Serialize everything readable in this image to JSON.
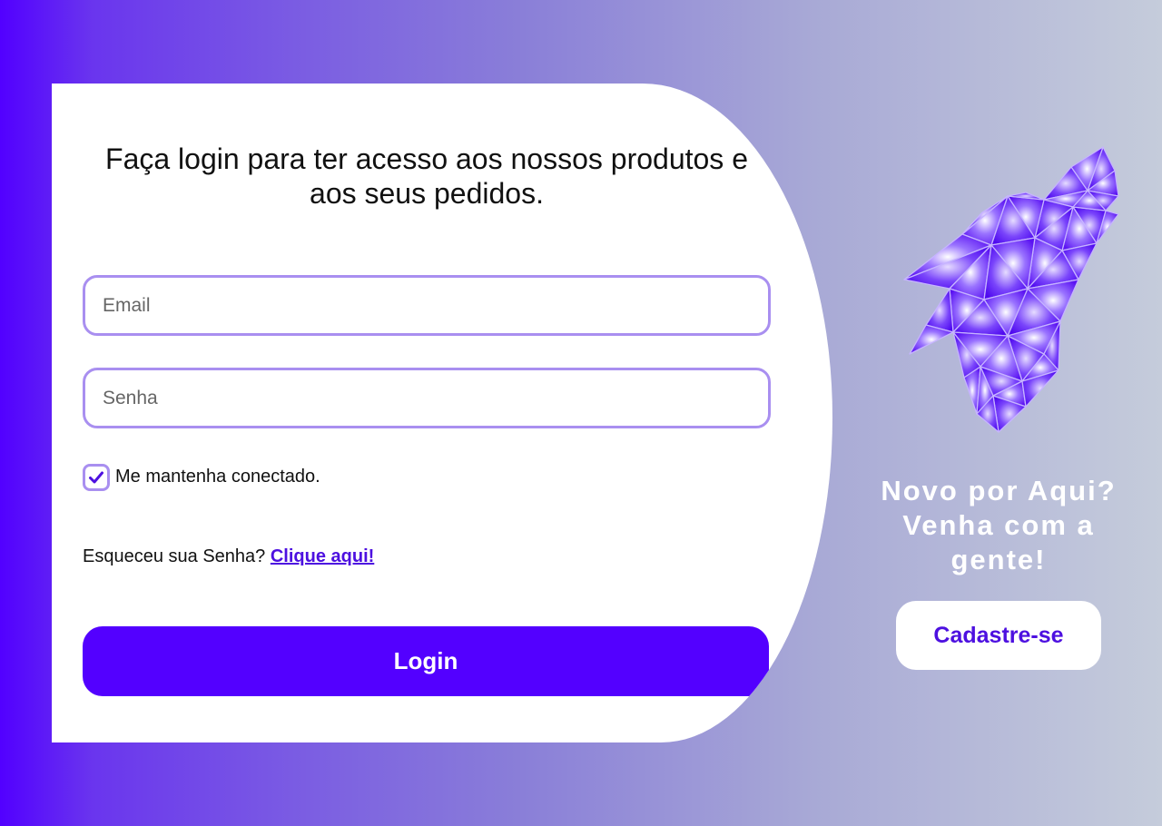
{
  "login": {
    "headline": "Faça login para ter acesso aos nossos produtos e aos seus pedidos.",
    "email_placeholder": "Email",
    "password_placeholder": "Senha",
    "remember_label": "Me mantenha conectado.",
    "remember_checked": true,
    "forgot_text": "Esqueceu sua Senha?",
    "forgot_link": "Clique aqui!",
    "login_button": "Login"
  },
  "signup": {
    "title": "Novo por Aqui? Venha com a gente!",
    "button": "Cadastre-se"
  },
  "icons": {
    "logo": "wolf-logo-icon",
    "check": "check-icon"
  },
  "colors": {
    "accent": "#5300ff",
    "link": "#4d10e0",
    "field_border": "#a98ff0",
    "card": "#ffffff"
  }
}
